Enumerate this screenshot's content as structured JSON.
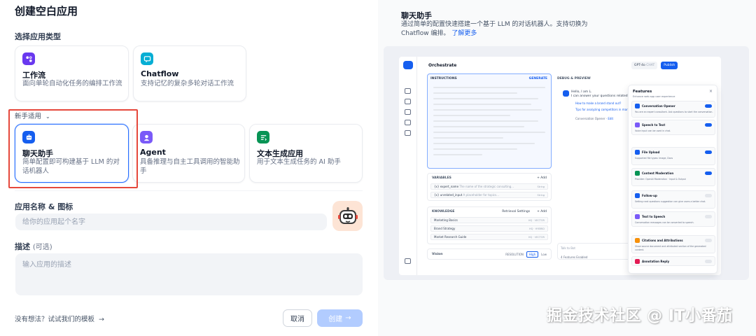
{
  "left": {
    "title": "创建空白应用",
    "app_type_label": "选择应用类型",
    "top_cards": [
      {
        "title": "工作流",
        "desc": "面向单轮自动化任务的编排工作流",
        "icon": "workflow-icon",
        "color": "#6938ef"
      },
      {
        "title": "Chatflow",
        "desc": "支持记忆的复杂多轮对话工作流",
        "icon": "chatflow-icon",
        "color": "#06aed4"
      }
    ],
    "newbie_label": "新手适用",
    "bottom_cards": [
      {
        "title": "聊天助手",
        "desc": "简单配置即可构建基于 LLM 的对话机器人",
        "icon": "chat-robot-icon",
        "color": "#155eef"
      },
      {
        "title": "Agent",
        "desc": "具备推理与自主工具调用的智能助手",
        "icon": "agent-icon",
        "color": "#7a5af8"
      },
      {
        "title": "文本生成应用",
        "desc": "用于文本生成任务的 AI 助手",
        "icon": "text-generator-icon",
        "color": "#079455"
      }
    ],
    "name_label": "应用名称 & 图标",
    "name_placeholder": "给你的应用起个名字",
    "desc_label": "描述",
    "desc_optional": "(可选)",
    "desc_placeholder": "输入应用的描述",
    "footer_link": "没有想法？试试我们的模板",
    "cancel_label": "取消",
    "create_label": "创建"
  },
  "right": {
    "title": "聊天助手",
    "desc": "通过简单的配置快速搭建一个基于 LLM 的对话机器人。支持切换为 Chatflow 编排。",
    "learn_more": "了解更多",
    "watermark": "掘金技术社区 @ IT小番茄",
    "preview": {
      "header": "Orchestrate",
      "model": "GPT-4o",
      "model_tag": "CHAT",
      "publish": "Publish",
      "instructions": "INSTRUCTIONS",
      "generate": "GENERATE",
      "variables": "VARIABLES",
      "add": "Add",
      "variable_rows": [
        {
          "name": "{x} expert_name",
          "desc": "The name of the strategic consulting…",
          "type": "String"
        },
        {
          "name": "{x} unrelated_input",
          "desc": "A placeholder for topics…",
          "type": "String"
        }
      ],
      "knowledge": "KNOWLEDGE",
      "retrieval": "Retrieval Settings",
      "knowledge_rows": [
        {
          "name": "Marketing Basics",
          "tag": "HQ · VECTOR"
        },
        {
          "name": "Brand Strategy",
          "tag": "HQ · HYBRID"
        },
        {
          "name": "Market Research Guide",
          "tag": "HQ · VECTOR"
        }
      ],
      "vision": "Vision",
      "resolution": "RESOLUTION",
      "high": "High",
      "low": "Low",
      "debug": "DEBUG & PREVIEW",
      "greeting_1": "Hello, I am L.",
      "greeting_2": "I can answer your questions related",
      "suggestions": [
        "How to make a brand stand out?",
        "Tips for analyzing competitors in market"
      ],
      "opener_note": "Conversation Opener",
      "edit": "Edit",
      "talk_placeholder": "Talk to Bot",
      "features_enabled": "4 Features Enabled",
      "features_title": "Features",
      "features_sub": "Enhance web app user experience",
      "features": [
        {
          "title": "Conversation Opener",
          "desc": "You are an expert consultant. Ask questions to start the conversation.",
          "on": true,
          "color": "#155eef"
        },
        {
          "title": "Speech to Text",
          "desc": "Voice input can be used in chat.",
          "on": true,
          "color": "#7a5af8"
        },
        {
          "title": "File Upload",
          "desc": "Supported file types: Image, Docs",
          "on": true,
          "color": "#155eef"
        },
        {
          "title": "Content Moderation",
          "desc": "Provider: OpenAI Moderation · Input & Output",
          "on": true,
          "color": "#079455"
        },
        {
          "title": "Follow-up",
          "desc": "Setting next questions suggestion can give users a better chat.",
          "on": false,
          "color": "#155eef"
        },
        {
          "title": "Text to Speech",
          "desc": "Conversation messages can be converted to speech.",
          "on": false,
          "color": "#7a5af8"
        },
        {
          "title": "Citations and Attributions",
          "desc": "Show source document and attributed section of the generated content.",
          "on": false,
          "color": "#f79009"
        },
        {
          "title": "Annotation Reply",
          "desc": "",
          "on": false,
          "color": "#e31b54"
        }
      ]
    }
  }
}
